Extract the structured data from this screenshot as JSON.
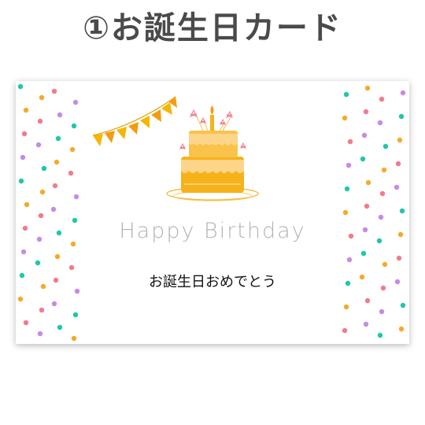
{
  "title": "①お誕生日カード",
  "card": {
    "headline": "Happy Birthday",
    "message": "お誕生日おめでとう"
  },
  "colors": {
    "title_text": "#4a4a4a",
    "headline_text": "#b3b3b3",
    "message_text": "#111111",
    "confetti": [
      "#1fc7a8",
      "#f7a928",
      "#f17b8e",
      "#c58be6"
    ],
    "cake_dark": "#f6b21a",
    "cake_light": "#fcd58a",
    "bunting": [
      "#f7b500",
      "#f39c12"
    ]
  },
  "icons": [
    "birthday-cake-icon",
    "bunting-flags-icon",
    "confetti-decoration"
  ]
}
